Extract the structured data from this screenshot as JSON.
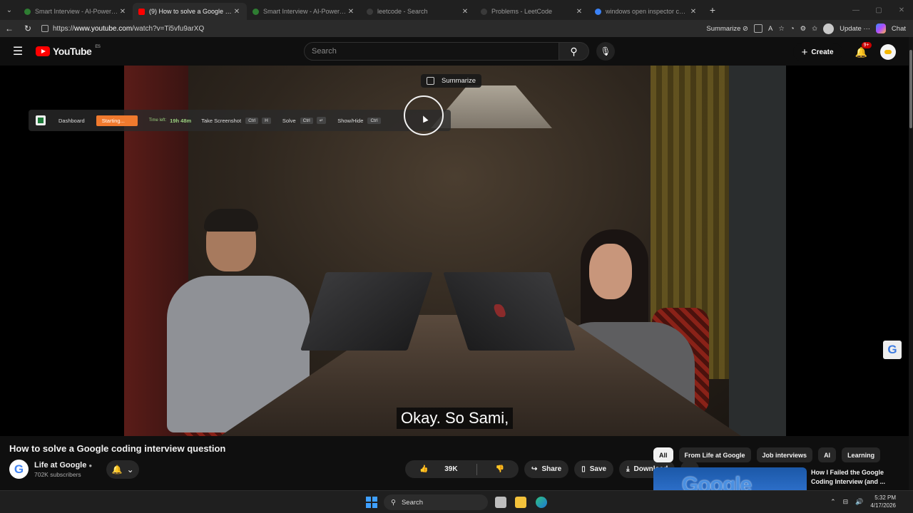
{
  "browser": {
    "tabs": [
      {
        "title": "Smart Interview - AI-Powered Inte",
        "active": false,
        "favicon_color": "#2e7d32"
      },
      {
        "title": "(9) How to solve a Google coding",
        "active": true,
        "favicon_color": "#ff0000"
      },
      {
        "title": "Smart Interview - AI-Powered Inte",
        "active": false,
        "favicon_color": "#2e7d32"
      },
      {
        "title": "leetcode - Search",
        "active": false,
        "favicon_color": "#3a3a3a"
      },
      {
        "title": "Problems - LeetCode",
        "active": false,
        "favicon_color": "#3a3a3a"
      },
      {
        "title": "windows open inspector chrome",
        "active": false,
        "favicon_color": "#3b82f6"
      }
    ],
    "url_prefix": "https://",
    "url_host": "www.youtube.com",
    "url_path": "/watch?v=Ti5vfu9arXQ",
    "summarize_label": "Summarize",
    "update_label": "Update",
    "chat_label": "Chat"
  },
  "youtube": {
    "logo_text": "YouTube",
    "country_code": "ES",
    "search_placeholder": "Search",
    "create_label": "Create",
    "notifications_badge": "9+"
  },
  "player": {
    "summarize_popup": "Summarize",
    "overlay": {
      "dashboard": "Dashboard",
      "status": "Starting...",
      "time_left_label": "Time left:",
      "time_left_value": "19h 48m",
      "screenshot_label": "Take Screenshot",
      "screenshot_key1": "Ctrl",
      "screenshot_key2": "H",
      "solve_label": "Solve",
      "solve_key1": "Ctrl",
      "solve_key2": "↵",
      "showhide_label": "Show/Hide",
      "showhide_key1": "Ctrl"
    },
    "caption": "Okay. So Sami,"
  },
  "video": {
    "title": "How to solve a Google coding interview question",
    "channel_name": "Life at Google",
    "subscribers": "702K subscribers",
    "likes": "39K",
    "share_label": "Share",
    "save_label": "Save",
    "download_label": "Download"
  },
  "sidebar": {
    "chips": [
      "All",
      "From Life at Google",
      "Job interviews",
      "AI",
      "Learning"
    ],
    "rec_title": "How I Failed the Google Coding Interview (and ...",
    "rec_thumb_text": "Google"
  },
  "taskbar": {
    "search_label": "Search",
    "time": "5:32 PM",
    "date": "4/17/2026"
  },
  "colors": {
    "brand_red": "#ff0000",
    "overlay_orange": "#f07a2e",
    "overlay_green": "#9ad07f"
  }
}
